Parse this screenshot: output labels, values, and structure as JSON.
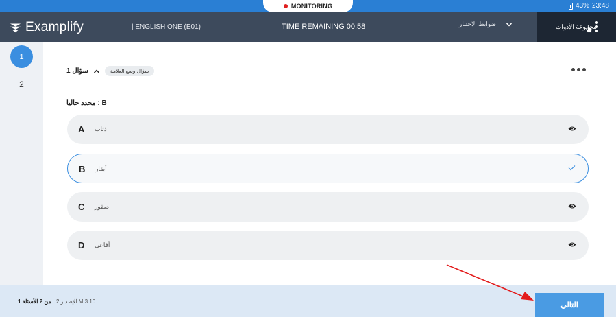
{
  "status_bar": {
    "monitoring_label": "MONITORING",
    "battery": "43%",
    "time": "23:48"
  },
  "header": {
    "app_name": "Examplify",
    "exam_title": "| ENGLISH ONE (E01)",
    "time_remaining": "TIME REMAINING 00:58",
    "exam_controls_label": "ضوابط الاختبار",
    "tools_label": "مجموعة الأدوات"
  },
  "question_nav": {
    "items": [
      "1",
      "2"
    ],
    "active": "1"
  },
  "question": {
    "label": "سؤال 1",
    "flag_label": "سؤال وضع العلامة",
    "selected_label": "محدد حاليا : B",
    "options": [
      {
        "letter": "A",
        "text": "ذئاب",
        "state": "eye"
      },
      {
        "letter": "B",
        "text": "أبقار",
        "state": "selected"
      },
      {
        "letter": "C",
        "text": "صقور",
        "state": "eye"
      },
      {
        "letter": "D",
        "text": "أفاعي",
        "state": "eye"
      }
    ]
  },
  "footer": {
    "question_count": "من 2 الأسئلة 1",
    "version": "الإصدار 2 M.3.10",
    "next_label": "التالي"
  },
  "colors": {
    "status_bar": "#2a7fd4",
    "top_bar": "#3d4a5c",
    "tools_bg": "#1d2633",
    "accent": "#3a8ee0",
    "footer_bg": "#dce8f5",
    "next_button": "#4a9be3",
    "annotation_arrow": "#e31b1b"
  },
  "icons": {
    "logo": "examplify-logo-icon",
    "controls_chevron": "chevron-down-icon",
    "tools_menu": "kebab-menu-icon",
    "cursor": "hand-cursor-icon",
    "question_caret": "caret-up-icon",
    "question_menu": "more-horizontal-icon",
    "option_eye": "eye-icon",
    "option_check": "checkmark-icon",
    "annotation": "red-arrow-icon"
  }
}
